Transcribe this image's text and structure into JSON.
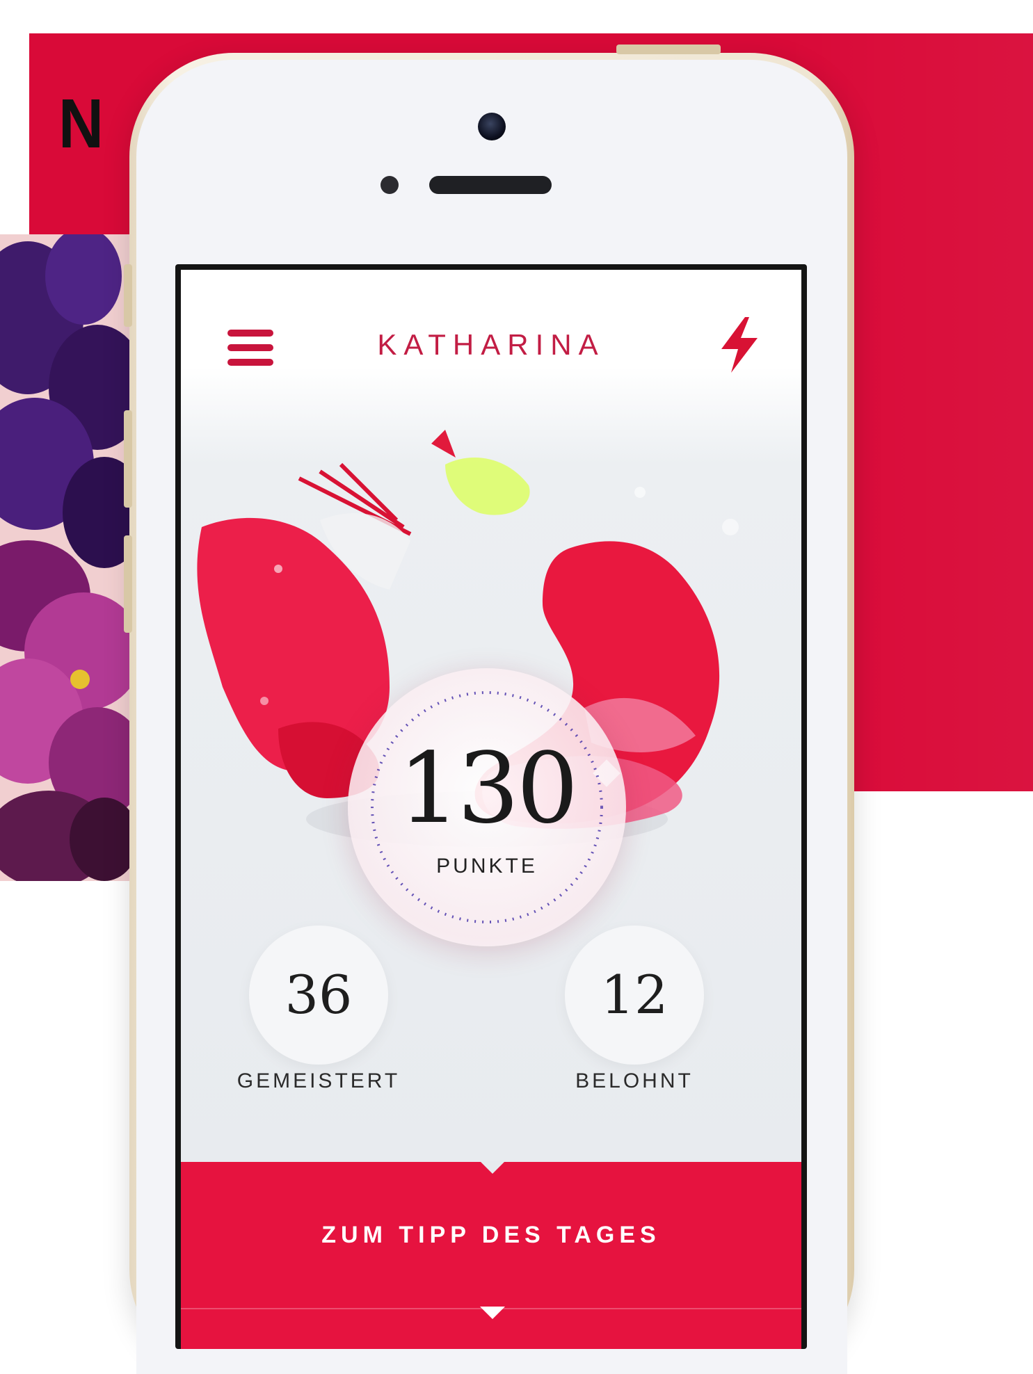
{
  "brand": {
    "letter": "N"
  },
  "app": {
    "title": "KATHARINA",
    "score": {
      "value": "130",
      "label": "PUNKTE"
    },
    "stats": [
      {
        "value": "36",
        "label": "GEMEISTERT"
      },
      {
        "value": "12",
        "label": "BELOHNT"
      }
    ],
    "cta": {
      "label": "ZUM TIPP DES TAGES"
    }
  },
  "icons": {
    "menu": "hamburger-menu-icon",
    "action": "lightning-bolt-icon",
    "next": "chevron-down-icon"
  },
  "colors": {
    "brand_red": "#d90a38",
    "accent_red": "#e6133f",
    "title_red": "#c21d44",
    "screen_bg": "#e7eaee"
  }
}
